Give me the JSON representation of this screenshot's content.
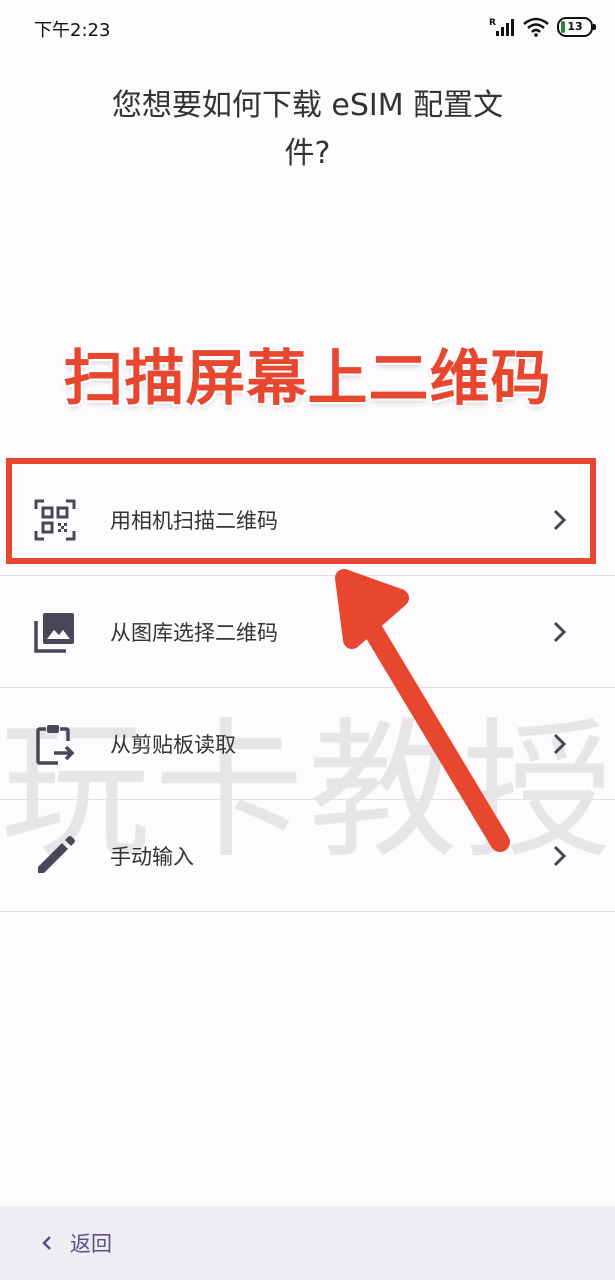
{
  "status_bar": {
    "time": "下午2:23",
    "battery": "13",
    "icons": [
      "signal-roaming-icon",
      "wifi-icon",
      "battery-icon"
    ]
  },
  "page": {
    "title": "您想要如何下载 eSIM 配置文件?"
  },
  "annotation": {
    "text": "扫描屏幕上二维码",
    "color": "#e8472f"
  },
  "options": [
    {
      "label": "用相机扫描二维码",
      "icon": "qr-scan-icon"
    },
    {
      "label": "从图库选择二维码",
      "icon": "gallery-icon"
    },
    {
      "label": "从剪贴板读取",
      "icon": "clipboard-paste-icon"
    },
    {
      "label": "手动输入",
      "icon": "pencil-icon"
    }
  ],
  "watermark": "玩卡教授",
  "bottom_bar": {
    "back_label": "返回"
  },
  "colors": {
    "accent": "#5b4d8f",
    "icon": "#4a4658",
    "divider": "#e3e0e4",
    "background": "#fdfbfd"
  }
}
